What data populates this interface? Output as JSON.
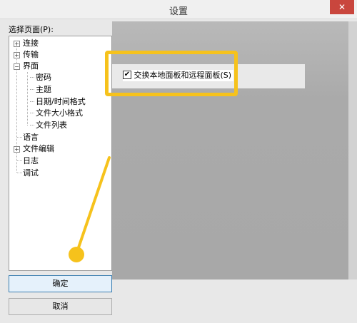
{
  "window": {
    "title": "设置",
    "close_glyph": "✕"
  },
  "tree": {
    "label": "选择页面(P):",
    "items": [
      {
        "label": "连接",
        "expander": "+"
      },
      {
        "label": "传输",
        "expander": "+"
      },
      {
        "label": "界面",
        "expander": "−"
      },
      {
        "label": "密码"
      },
      {
        "label": "主题"
      },
      {
        "label": "日期/时间格式"
      },
      {
        "label": "文件大小格式"
      },
      {
        "label": "文件列表"
      },
      {
        "label": "语言"
      },
      {
        "label": "文件编辑",
        "expander": "+"
      },
      {
        "label": "日志"
      },
      {
        "label": "调试"
      }
    ]
  },
  "content": {
    "checkbox_label": "交换本地面板和远程面板(S)",
    "checkbox_checked": true,
    "check_glyph": "✔"
  },
  "buttons": {
    "ok": "确定",
    "cancel": "取消"
  },
  "colors": {
    "highlight": "#f6c21c",
    "close": "#c9463d"
  }
}
